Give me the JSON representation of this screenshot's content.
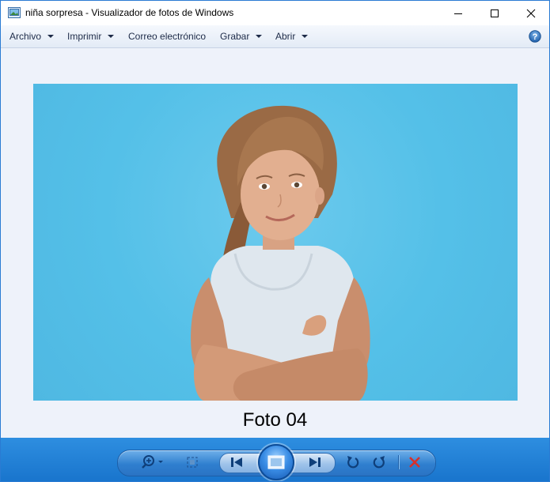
{
  "window": {
    "title": "niña sorpresa - Visualizador de fotos de Windows"
  },
  "menu": {
    "items": [
      {
        "label": "Archivo",
        "has_dropdown": true
      },
      {
        "label": "Imprimir",
        "has_dropdown": true
      },
      {
        "label": "Correo electrónico",
        "has_dropdown": false
      },
      {
        "label": "Grabar",
        "has_dropdown": true
      },
      {
        "label": "Abrir",
        "has_dropdown": true
      }
    ],
    "help_icon": "help-icon"
  },
  "photo": {
    "caption": "Foto 04",
    "background_color": "#54c0e8"
  },
  "controls": {
    "icons": [
      "zoom-icon",
      "fit-window-icon",
      "previous-icon",
      "slideshow-icon",
      "next-icon",
      "rotate-left-icon",
      "rotate-right-icon",
      "delete-icon"
    ]
  },
  "colors": {
    "accent": "#1874cc",
    "delete": "#d9302a"
  }
}
